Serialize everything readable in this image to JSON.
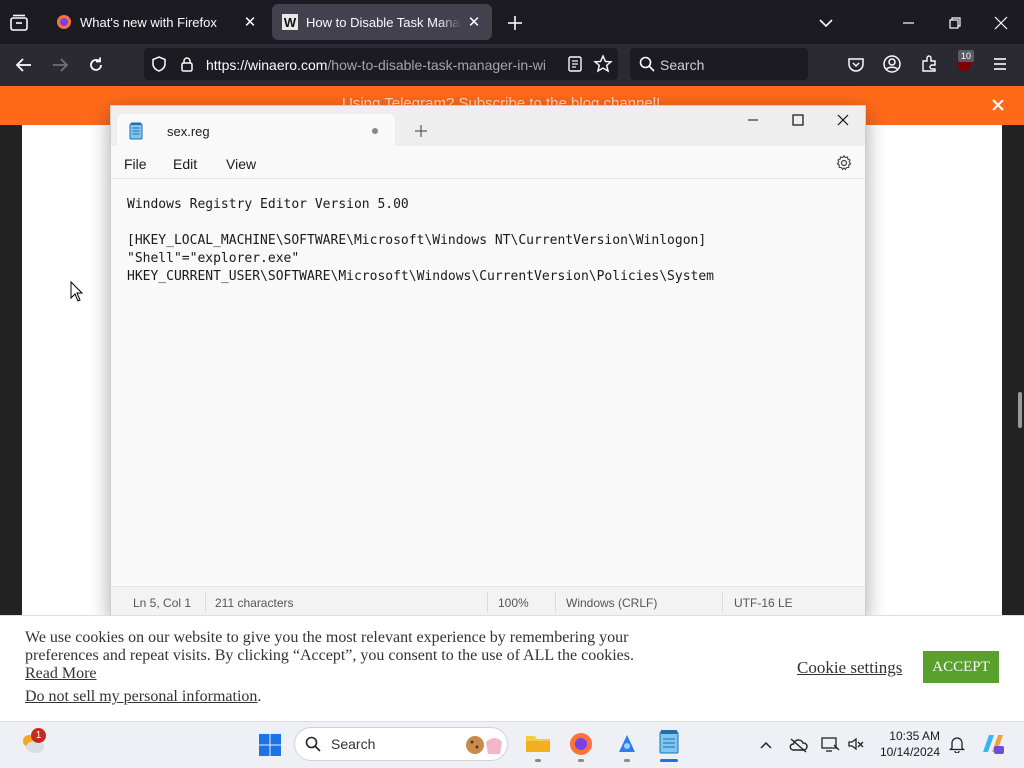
{
  "browser": {
    "tabs": [
      {
        "title": "What's new with Firefox",
        "active": false
      },
      {
        "title": "How to Disable Task Manager",
        "active": true
      }
    ],
    "url_host": "https://winaero.com",
    "url_path": "/how-to-disable-task-manager-in-wi",
    "search_placeholder": "Search",
    "extensions_badge": "10"
  },
  "page": {
    "banner_text": "Using Telegram? Subscribe to the blog channel!",
    "cookie": {
      "line1": "We use cookies on our website to give you the most relevant experience by remembering your",
      "line2": "preferences and repeat visits. By clicking “Accept”, you consent to the use of ALL the cookies.",
      "read_more": "Read More",
      "do_not_sell": "Do not sell my personal information",
      "period": ".",
      "settings_label": "Cookie settings",
      "accept_label": "ACCEPT"
    }
  },
  "notepad": {
    "tab_title": "sex.reg",
    "menu": [
      "File",
      "Edit",
      "View"
    ],
    "content": "Windows Registry Editor Version 5.00\n\n[HKEY_LOCAL_MACHINE\\SOFTWARE\\Microsoft\\Windows NT\\CurrentVersion\\Winlogon]\n\"Shell\"=\"explorer.exe\"\nHKEY_CURRENT_USER\\SOFTWARE\\Microsoft\\Windows\\CurrentVersion\\Policies\\System",
    "status": {
      "position": "Ln 5, Col 1",
      "characters": "211 characters",
      "zoom": "100%",
      "line_ending": "Windows (CRLF)",
      "encoding": "UTF-16 LE"
    }
  },
  "taskbar": {
    "weather_badge": "1",
    "search_placeholder": "Search",
    "time": "10:35 AM",
    "date": "10/14/2024"
  },
  "colors": {
    "banner": "#ff6a1a",
    "accept": "#5aa02c",
    "firefox_tabbar": "#1c1b22"
  }
}
